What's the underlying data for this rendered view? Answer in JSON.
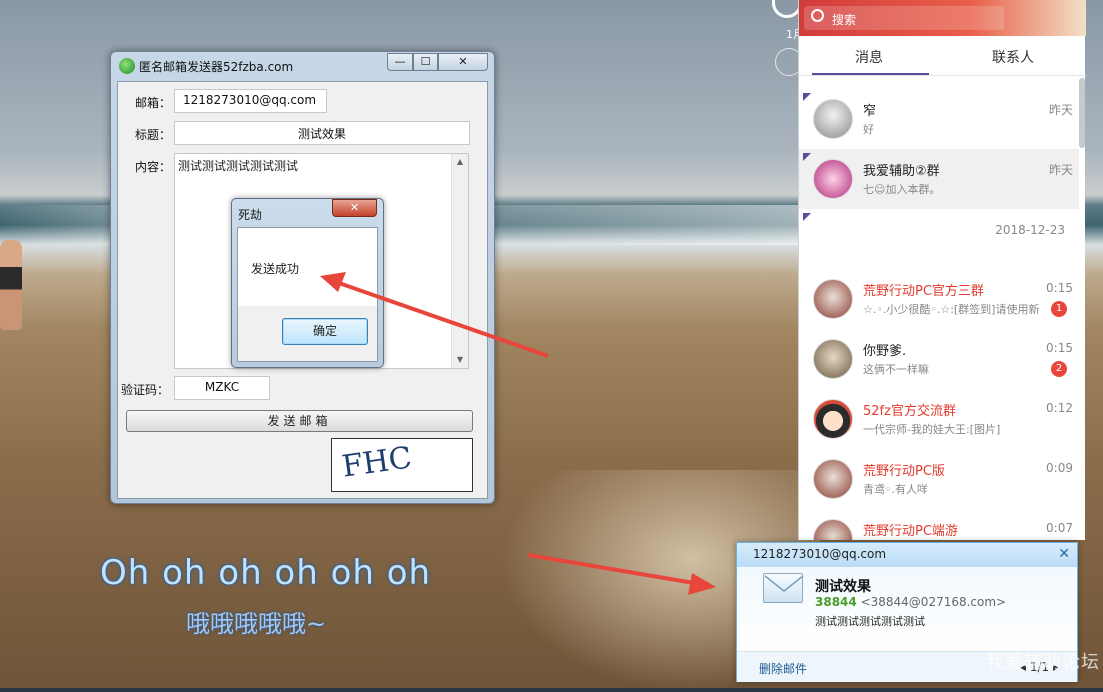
{
  "background": {
    "overlay_line1": "Oh oh oh oh oh oh",
    "overlay_line2": "哦哦哦哦哦~",
    "desk_date_fragment": "1月"
  },
  "app_window": {
    "title": "匿名邮箱发送器52fzba.com",
    "min_label": "—",
    "max_label": "☐",
    "close_label": "✕",
    "email_label": "邮箱：",
    "email_value": "1218273010@qq.com",
    "subject_label": "标题：",
    "subject_value": "测试效果",
    "content_label": "内容：",
    "content_value": "测试测试测试测试测试",
    "captcha_label": "验证码：",
    "captcha_value": "MZKC",
    "send_button": "发送邮箱",
    "captcha_image_text": "FHC"
  },
  "dialog": {
    "title": "死劫",
    "close_label": "✕",
    "message": "发送成功",
    "ok_button": "确定"
  },
  "qq_panel": {
    "search_placeholder": "搜索",
    "tabs": [
      {
        "label": "消息"
      },
      {
        "label": "联系人"
      }
    ],
    "items": [
      {
        "name": "窄",
        "msg": "好",
        "time": "昨天",
        "badge": ""
      },
      {
        "name": "我爱辅助②群",
        "msg": "七☺加入本群。",
        "time": "昨天",
        "badge": ""
      },
      {
        "date_divider": "2018-12-23"
      },
      {
        "name": "荒野行动PC官方三群",
        "msg": "☆.◦.小少很酷◦.☆:[群签到]请使用新",
        "time": "0:15",
        "badge": "1"
      },
      {
        "name": "你野爹.",
        "msg": "这俩不一样嘛",
        "time": "0:15",
        "badge": "2"
      },
      {
        "name": "52fz官方交流群",
        "msg": "一代宗师-我的娃大王:[图片]",
        "time": "0:12",
        "badge": ""
      },
      {
        "name": "荒野行动PC版",
        "msg": "青鸢◦.有人咩",
        "time": "0:09",
        "badge": ""
      },
      {
        "name": "荒野行动PC端游",
        "msg": "",
        "time": "0:07",
        "badge": ""
      }
    ],
    "colors": {
      "accent": "#5b4b9a",
      "red_name": "#e23b2e",
      "badge": "#e9463b"
    }
  },
  "mail_popup": {
    "from": "1218273010@qq.com",
    "close_label": "✕",
    "subject": "测试效果",
    "sender_name": "38844",
    "sender_addr": "<38844@027168.com>",
    "body": "测试测试测试测试测试",
    "delete_label": "删除邮件",
    "pager": "1/1"
  },
  "watermark": "我爱辅助论坛",
  "icons": [
    "app-logo-icon",
    "search-icon",
    "envelope-icon",
    "prev-icon",
    "next-icon",
    "scroll-up-icon",
    "scroll-down-icon"
  ]
}
